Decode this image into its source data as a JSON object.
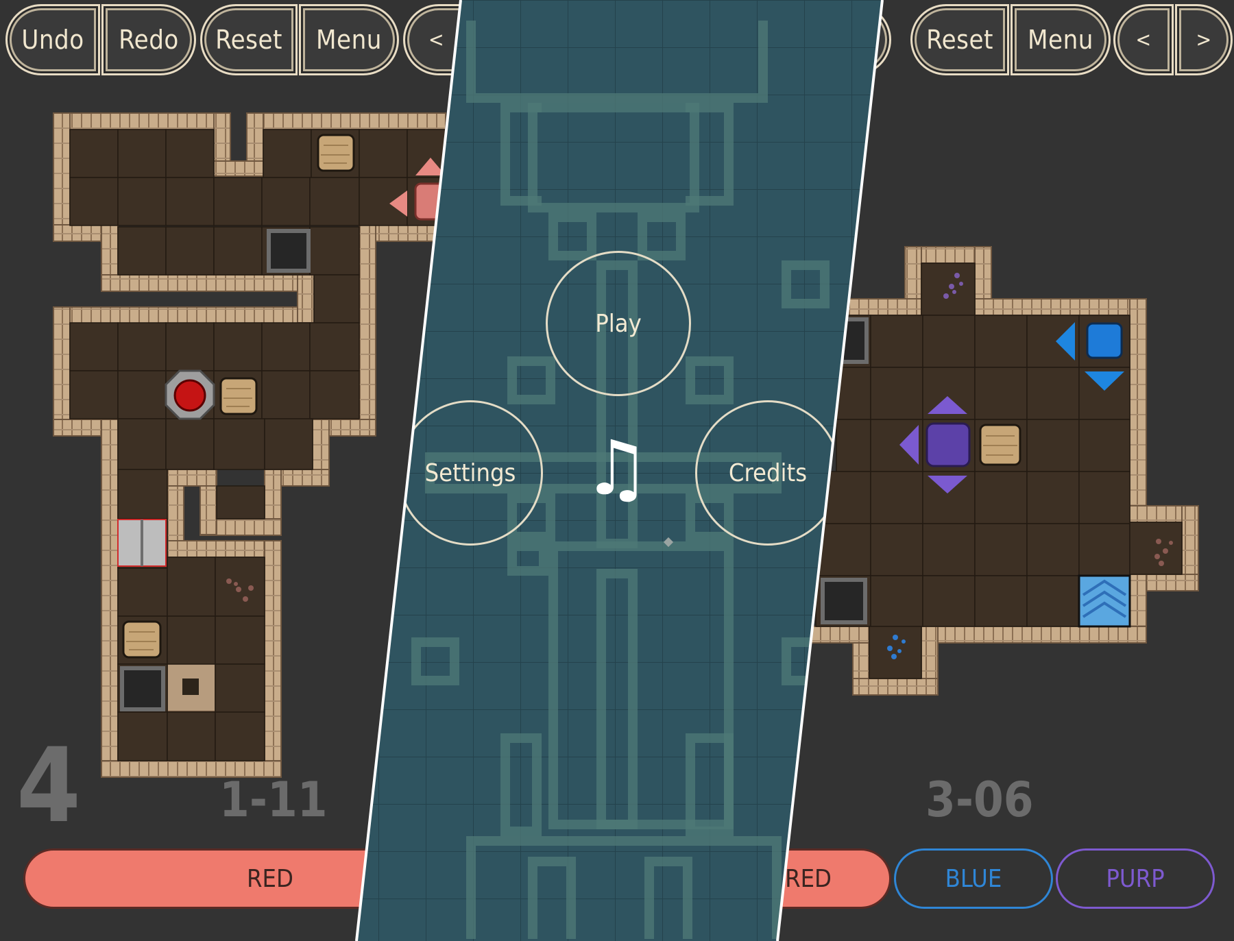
{
  "left_panel": {
    "toolbar": {
      "undo_label": "Undo",
      "redo_label": "Redo",
      "reset_label": "Reset",
      "menu_label": "Menu",
      "prev_label": "<"
    },
    "moves_count": "4",
    "level_label": "1-11",
    "color_button_label": "RED",
    "color_button_color": "#ef7a6d"
  },
  "middle_panel": {
    "play_label": "Play",
    "settings_label": "Settings",
    "credits_label": "Credits",
    "music_icon": "♫",
    "background_color": "#2f5460"
  },
  "right_panel": {
    "toolbar": {
      "reset_label": "Reset",
      "menu_label": "Menu",
      "prev_label": "<",
      "next_label": ">"
    },
    "level_label": "3-06",
    "color_buttons": {
      "red_label": "RED",
      "blue_label": "BLUE",
      "purple_label": "PURP",
      "red_color": "#ef7a6d",
      "blue_color": "#2f86d6",
      "purple_color": "#7e5ad0"
    }
  }
}
